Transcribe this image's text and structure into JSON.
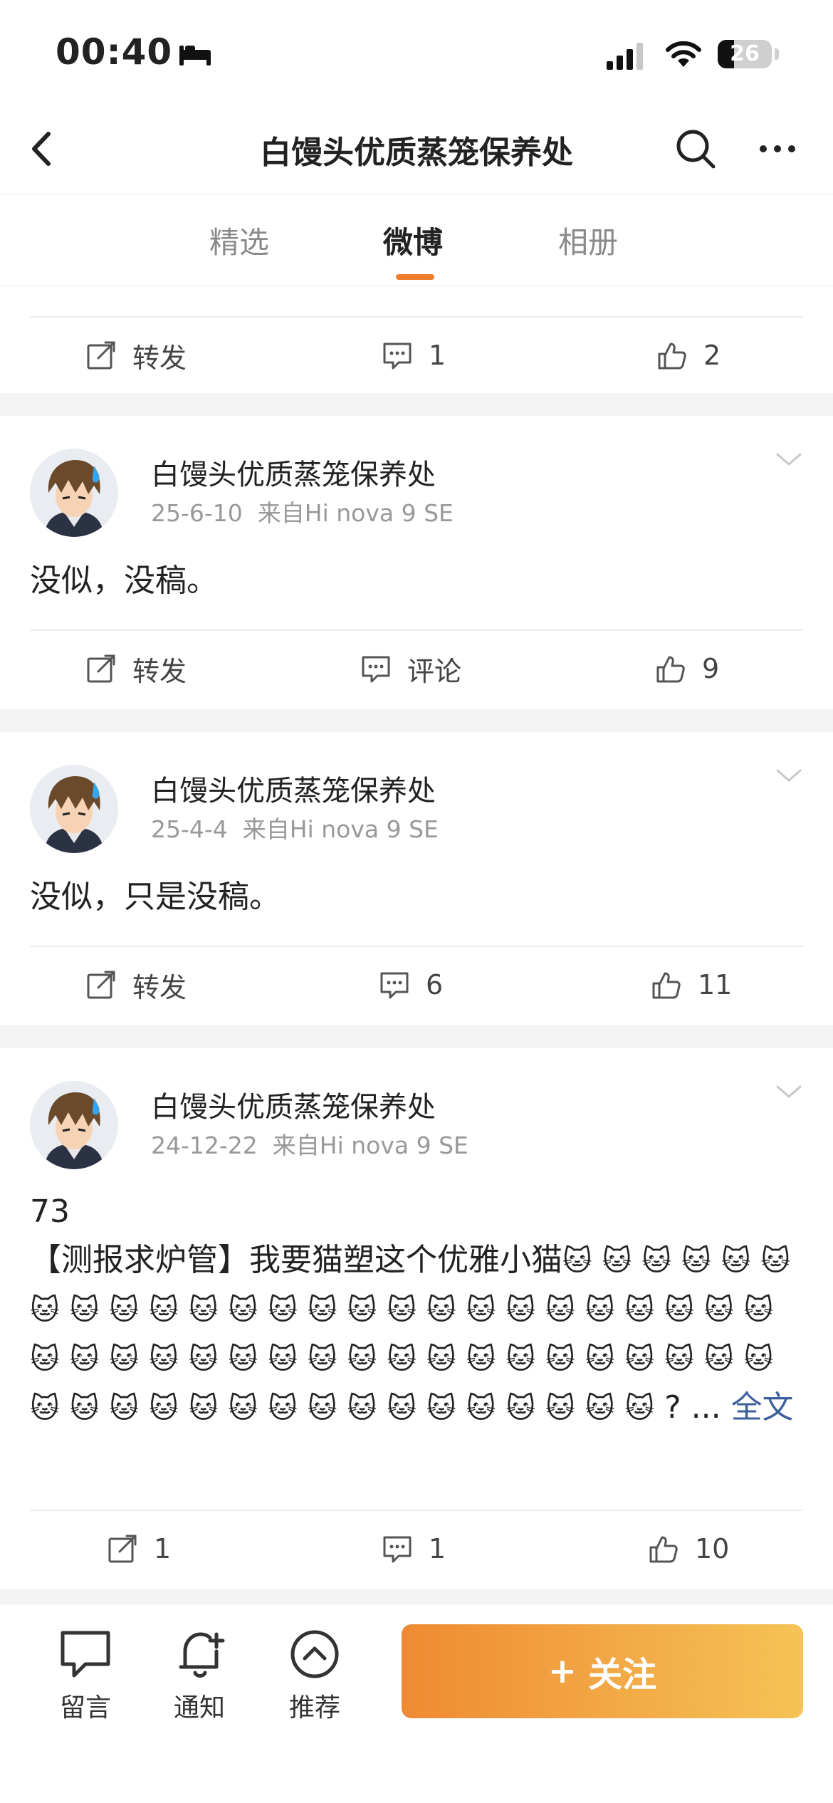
{
  "status_bar": {
    "time": "00:40",
    "battery": "26",
    "battery_level_percent": 26
  },
  "nav": {
    "title": "白馒头优质蒸笼保养处"
  },
  "tabs": [
    {
      "label": "精选",
      "active": false
    },
    {
      "label": "微博",
      "active": true
    },
    {
      "label": "相册",
      "active": false
    }
  ],
  "top_card": {
    "repost_label": "转发",
    "comments": "1",
    "likes": "2"
  },
  "posts": [
    {
      "author": "白馒头优质蒸笼保养处",
      "date": "25-6-10",
      "source": "来自Hi nova 9 SE",
      "text": "没似，没稿。",
      "repost_label": "转发",
      "comments": "评论",
      "likes": "9"
    },
    {
      "author": "白馒头优质蒸笼保养处",
      "date": "25-4-4",
      "source": "来自Hi nova 9 SE",
      "text": "没似，只是没稿。",
      "repost_label": "转发",
      "comments": "6",
      "likes": "11"
    },
    {
      "author": "白馒头优质蒸笼保养处",
      "date": "24-12-22",
      "source": "来自Hi nova 9 SE",
      "line1": "73",
      "line2": "【测报求炉管】我要猫塑这个优雅小猫",
      "cat_emoji": "🐱",
      "tail": "? ...",
      "full_text_link": "全文",
      "reposts": "1",
      "comments": "1",
      "likes": "10"
    }
  ],
  "bottom_bar": {
    "comment_label": "留言",
    "notify_label": "通知",
    "recommend_label": "推荐",
    "follow_label": "关注",
    "follow_plus": "+"
  },
  "colors": {
    "accent": "#f07d29",
    "link": "#3d5f9b",
    "follow_gradient_start": "#ef8a33",
    "follow_gradient_end": "#f5c356"
  }
}
